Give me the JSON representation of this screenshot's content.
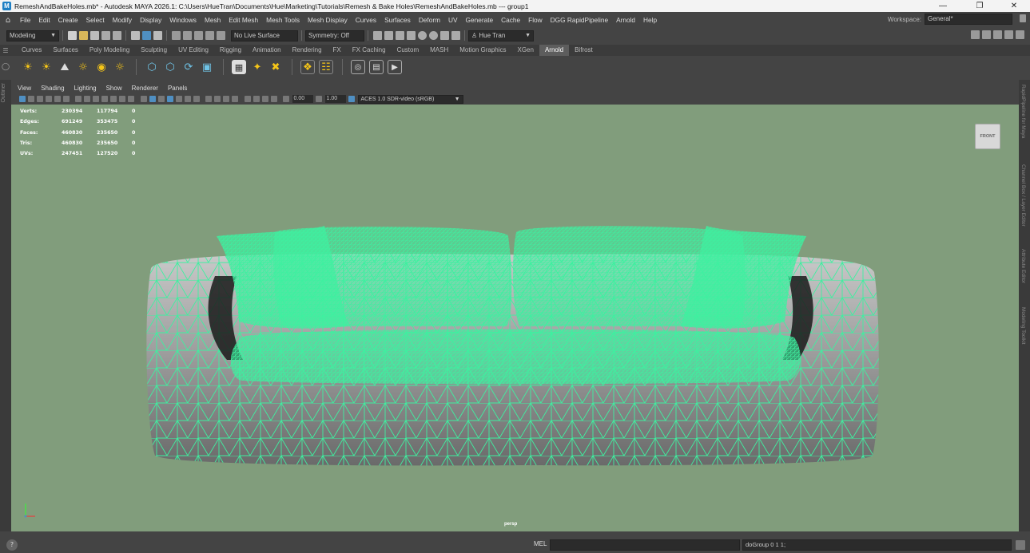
{
  "window": {
    "title": "RemeshAndBakeHoles.mb* - Autodesk MAYA 2026.1: C:\\Users\\HueTran\\Documents\\Hue\\Marketing\\Tutorials\\Remesh & Bake Holes\\RemeshAndBakeHoles.mb   ---   group1"
  },
  "menubar": {
    "items": [
      "File",
      "Edit",
      "Create",
      "Select",
      "Modify",
      "Display",
      "Windows",
      "Mesh",
      "Edit Mesh",
      "Mesh Tools",
      "Mesh Display",
      "Curves",
      "Surfaces",
      "Deform",
      "UV",
      "Generate",
      "Cache",
      "Flow",
      "DGG RapidPipeline",
      "Arnold",
      "Help"
    ],
    "workspace_label": "Workspace:",
    "workspace_value": "General*"
  },
  "statusline": {
    "mode": "Modeling",
    "live_surface": "No Live Surface",
    "symmetry": "Symmetry: Off",
    "user": "Hue Tran"
  },
  "shelf": {
    "tabs": [
      "Curves",
      "Surfaces",
      "Poly Modeling",
      "Sculpting",
      "UV Editing",
      "Rigging",
      "Animation",
      "Rendering",
      "FX",
      "FX Caching",
      "Custom",
      "MASH",
      "Motion Graphics",
      "XGen",
      "Arnold",
      "Bifrost"
    ],
    "active_tab": "Arnold"
  },
  "panel": {
    "menus": [
      "View",
      "Shading",
      "Lighting",
      "Show",
      "Renderer",
      "Panels"
    ],
    "exposure": "0.00",
    "gamma": "1.00",
    "color_space": "ACES 1.0 SDR-video (sRGB)"
  },
  "side_labels": {
    "left": "Outliner",
    "right": [
      "RapidPipeline for Maya",
      "Channel Box / Layer Editor",
      "Attribute Editor",
      "Modeling Toolkit"
    ]
  },
  "hud": {
    "rows": [
      {
        "label": "Verts:",
        "a": "230394",
        "b": "117794",
        "c": "0"
      },
      {
        "label": "Edges:",
        "a": "691249",
        "b": "353475",
        "c": "0"
      },
      {
        "label": "Faces:",
        "a": "460830",
        "b": "235650",
        "c": "0"
      },
      {
        "label": "Tris:",
        "a": "460830",
        "b": "235650",
        "c": "0"
      },
      {
        "label": "UVs:",
        "a": "247451",
        "b": "127520",
        "c": "0"
      }
    ]
  },
  "viewport": {
    "viewcube_label": "FRONT",
    "camera": "persp",
    "background": "#819d7c",
    "wire_color": "#3ef0a0"
  },
  "command_line": {
    "mode": "MEL",
    "result": "doGroup 0 1 1;"
  }
}
